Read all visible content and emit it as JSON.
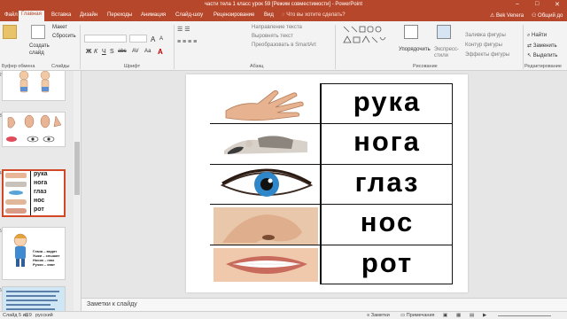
{
  "window": {
    "title": "части тела  1 класс урок 59 [Режим совместимости]  -  PowerPoint",
    "minimize": "–",
    "maximize": "□",
    "close": "✕"
  },
  "ribbon_tabs": {
    "file": "Файл",
    "home": "Главная",
    "insert": "Вставка",
    "design": "Дизайн",
    "transitions": "Переходы",
    "animations": "Анимация",
    "slideshow": "Слайд-шоу",
    "review": "Рецензирование",
    "view": "Вид",
    "tell_me": "Что вы хотите сделать?",
    "user": "Bek Venera",
    "share": "Общий до"
  },
  "ribbon": {
    "clipboard": {
      "cut": "Макет",
      "reset": "Сбросить",
      "new_slide": "Создать слайд",
      "group": "Буфер обмена"
    },
    "slides_group": "Слайды",
    "font_group": "Шрифт",
    "font_format": {
      "bold": "Ж",
      "italic": "К",
      "underline": "Ч",
      "strike": "S",
      "abc": "abc",
      "av": "AV",
      "aa": "Аа",
      "grow": "A",
      "shrink": "A"
    },
    "paragraph": {
      "text_direction": "Направление текста",
      "align_text": "Выровнять текст",
      "smartart": "Преобразовать в SmartArt",
      "group": "Абзац"
    },
    "drawing": {
      "arrange": "Упорядочить",
      "quick_styles": "Экспресс-стили",
      "fill": "Заливка фигуры",
      "outline": "Контур фигуры",
      "effects": "Эффекты фигуры",
      "group": "Рисование"
    },
    "editing": {
      "find": "Найти",
      "replace": "Заменить",
      "select": "Выделить",
      "group": "Редактирование"
    }
  },
  "thumbnails": [
    {
      "number": "2"
    },
    {
      "number": "3"
    },
    {
      "number": "4"
    },
    {
      "number": "5"
    },
    {
      "number": "6"
    }
  ],
  "thumb5": {
    "line1": "Глаза – видят",
    "line2": "Ушки – слышат",
    "line3": "Носик – нюх",
    "line4": "Ручки – хват"
  },
  "thumb_words": [
    "рука",
    "нога",
    "глаз",
    "нос",
    "рот"
  ],
  "slide": {
    "rows": [
      {
        "word": "рука",
        "image": "hand"
      },
      {
        "word": "нога",
        "image": "foot"
      },
      {
        "word": "глаз",
        "image": "eye"
      },
      {
        "word": "нос",
        "image": "nose"
      },
      {
        "word": "рот",
        "image": "mouth"
      }
    ]
  },
  "notes": {
    "placeholder": "Заметки к слайду"
  },
  "status": {
    "slide_counter": "Слайд 5 из 9",
    "language": "русский",
    "notes_btn": "Заметки",
    "comments_btn": "Примечания"
  },
  "colors": {
    "accent": "#b7472a",
    "selected_thumb": "#d24726"
  }
}
